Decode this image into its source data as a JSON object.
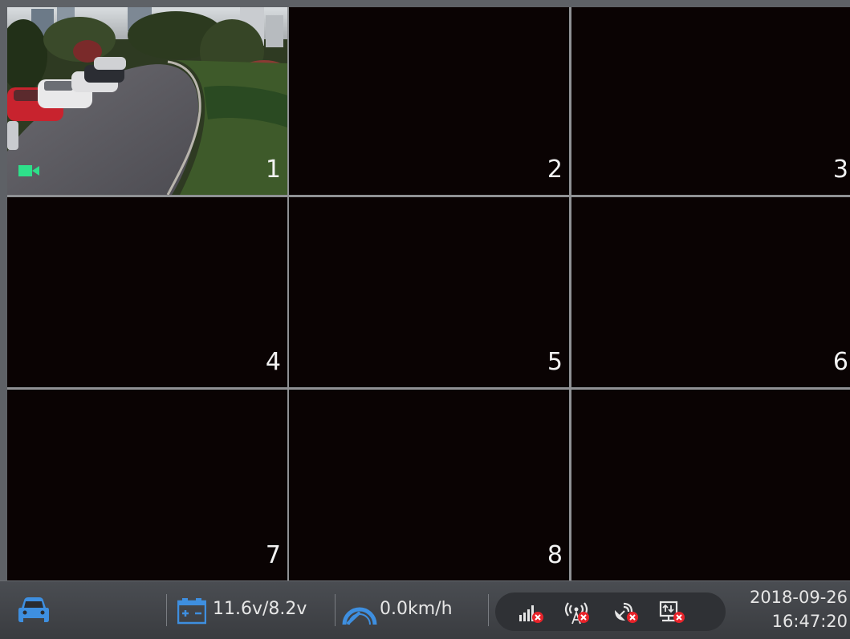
{
  "channels": [
    {
      "label": "1",
      "state": "recording"
    },
    {
      "label": "2",
      "state": "no-video"
    },
    {
      "label": "3",
      "state": "no-video"
    },
    {
      "label": "4",
      "state": "no-video"
    },
    {
      "label": "5",
      "state": "no-video"
    },
    {
      "label": "6",
      "state": "no-video"
    },
    {
      "label": "7",
      "state": "no-video"
    },
    {
      "label": "8",
      "state": "no-video"
    },
    {
      "label": "",
      "state": "empty"
    }
  ],
  "status_bar": {
    "vehicle_icon": "car-icon",
    "battery_icon": "battery-icon",
    "voltage": "11.6v/8.2v",
    "speed_icon": "speedometer-icon",
    "speed": "0.0km/h",
    "indicators": [
      {
        "icon": "cellular-signal-icon",
        "status": "disconnected"
      },
      {
        "icon": "wifi-ap-icon",
        "status": "disconnected"
      },
      {
        "icon": "satellite-gps-icon",
        "status": "disconnected"
      },
      {
        "icon": "server-connection-icon",
        "status": "disconnected"
      }
    ],
    "date": "2018-09-26",
    "time": "16:47:20"
  },
  "colors": {
    "record_indicator": "#2ee08a",
    "alert_red": "#e8232a",
    "icon_blue": "#3e8fe0",
    "cell_bg": "#0a0303"
  }
}
